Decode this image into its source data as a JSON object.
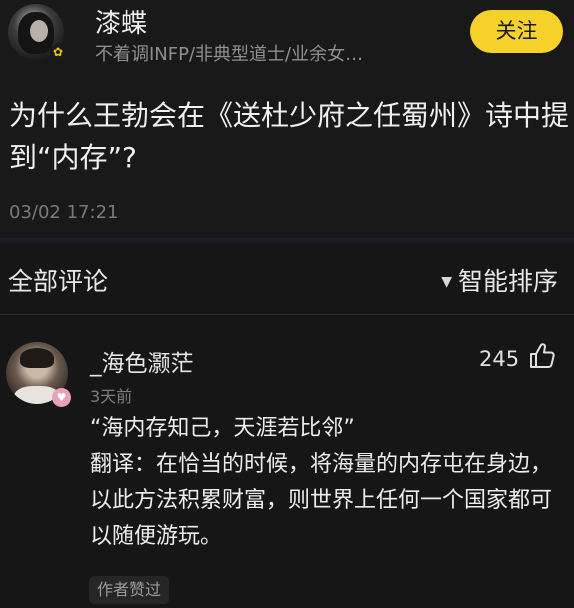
{
  "post": {
    "author": {
      "name": "漆蝶",
      "bio": "不着调INFP/非典型道士/业余女…",
      "avatar_icon": "user-avatar",
      "badge_icon": "flower-badge-icon"
    },
    "follow_label": "关注",
    "question": "为什么王勃会在《送杜少府之任蜀州》诗中提到“内存”?",
    "time": "03/02 17:21"
  },
  "comments_section": {
    "title": "全部评论",
    "sort_icon": "triangle-down-icon",
    "sort_label": "智能排序"
  },
  "comment": {
    "author_name": "_海色灏茫",
    "time": "3天前",
    "likes": "245",
    "like_icon": "thumbs-up-icon",
    "badge_icon": "heart-badge-icon",
    "quote": "“海内存知己，天涯若比邻”",
    "translation": "翻译：在恰当的时候，将海量的内存屯在身边，以此方法积累财富，则世界上任何一个国家都可以随便游玩。",
    "author_liked_tag": "作者赞过"
  },
  "colors": {
    "follow_button": "#f5d12a",
    "background": "#161616"
  }
}
